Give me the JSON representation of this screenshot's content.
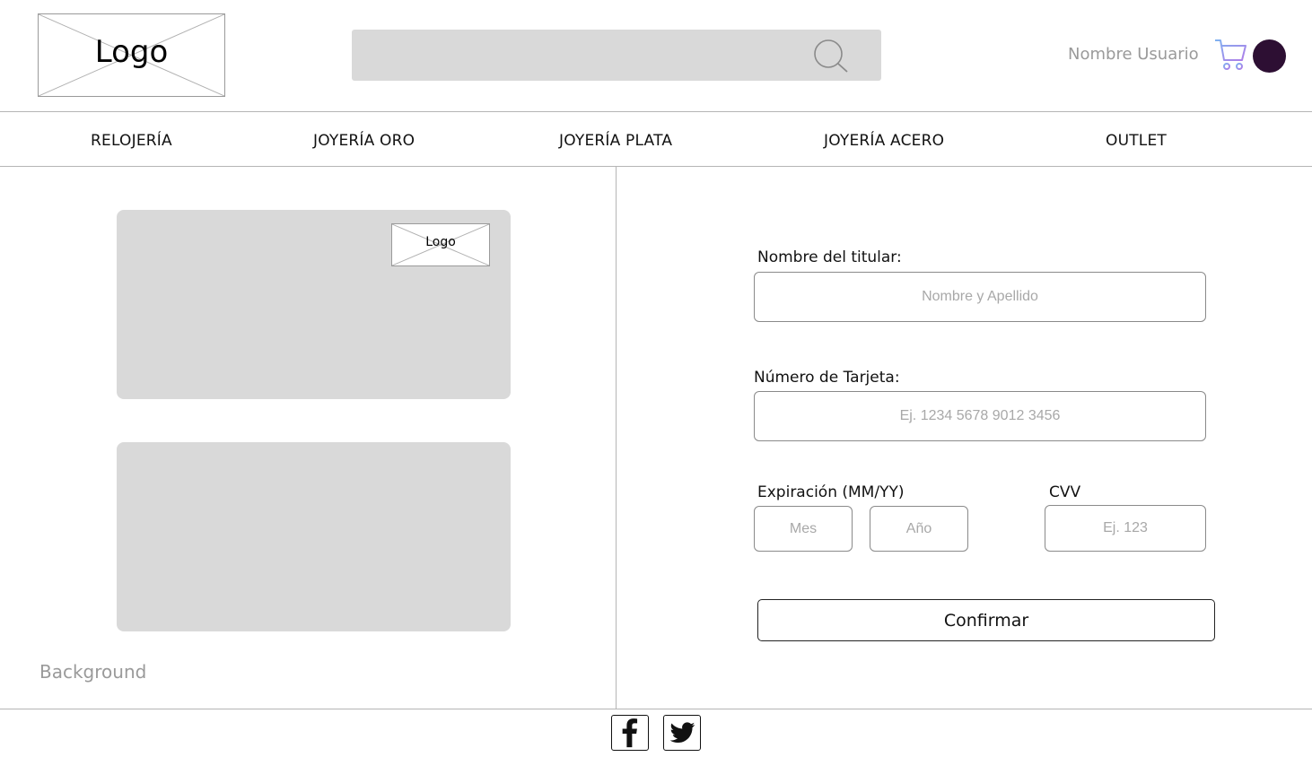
{
  "header": {
    "logo_text": "Logo",
    "search": {
      "value": "",
      "placeholder": "",
      "icon": "search-icon"
    },
    "user_name": "Nombre Usuario",
    "cart_icon": "cart-add-icon",
    "avatar_color": "#2d0f33",
    "cart_color": "#9d8fe8"
  },
  "nav": {
    "items": [
      {
        "label": "RELOJERÍA"
      },
      {
        "label": "JOYERÍA ORO"
      },
      {
        "label": "JOYERÍA PLATA"
      },
      {
        "label": "JOYERÍA ACERO"
      },
      {
        "label": "OUTLET"
      }
    ]
  },
  "left_panel": {
    "card_logo_text": "Logo",
    "background_label": "Background"
  },
  "form": {
    "holder_label": "Nombre del titular:",
    "holder_placeholder": "Nombre y Apellido",
    "card_number_label": "Número de Tarjeta:",
    "card_number_placeholder": "Ej. 1234 5678 9012 3456",
    "expiry_label": "Expiración (MM/YY)",
    "month_placeholder": "Mes",
    "year_placeholder": "Año",
    "cvv_label": "CVV",
    "cvv_placeholder": "Ej. 123",
    "confirm_label": "Confirmar"
  },
  "footer": {
    "social_icons": [
      "facebook-icon",
      "twitter-icon"
    ]
  }
}
